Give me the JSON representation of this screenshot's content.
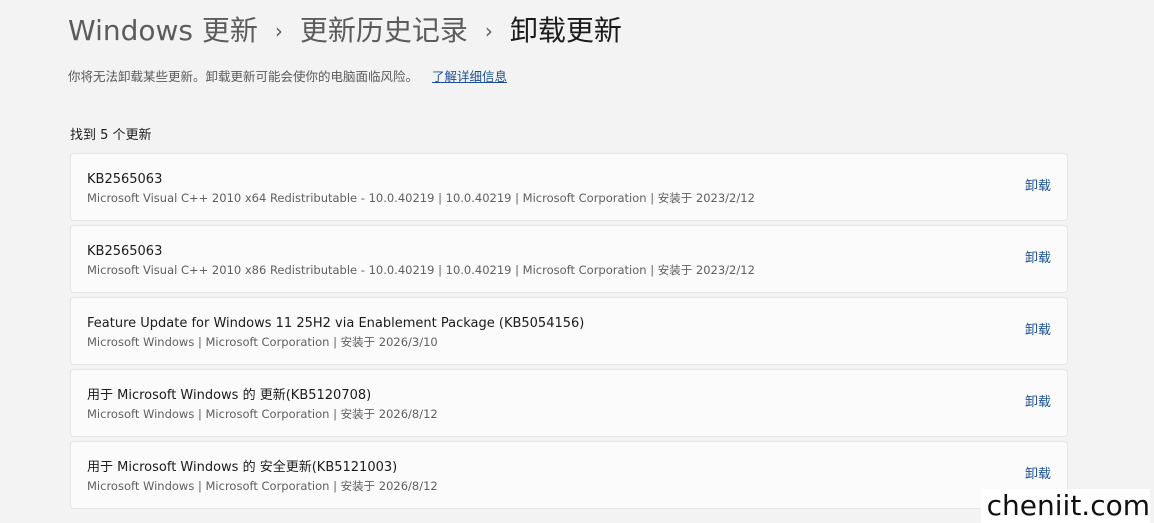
{
  "breadcrumb": {
    "items": [
      "Windows 更新",
      "更新历史记录",
      "卸载更新"
    ],
    "separator": "›"
  },
  "info": {
    "text": "你将无法卸载某些更新。卸载更新可能会使你的电脑面临风险。",
    "link": "了解详细信息"
  },
  "count_text": "找到 5 个更新",
  "updates": [
    {
      "title": "KB2565063",
      "details": "Microsoft Visual C++ 2010  x64 Redistributable - 10.0.40219  |  10.0.40219  |  Microsoft Corporation  |  安装于 2023/2/12",
      "action": "卸载"
    },
    {
      "title": "KB2565063",
      "details": "Microsoft Visual C++ 2010  x86 Redistributable - 10.0.40219  |  10.0.40219  |  Microsoft Corporation  |  安装于 2023/2/12",
      "action": "卸载"
    },
    {
      "title": "Feature Update for Windows 11 25H2 via Enablement Package (KB5054156)",
      "details": "Microsoft Windows  |  Microsoft Corporation  |  安装于 2026/3/10",
      "action": "卸载"
    },
    {
      "title": "用于 Microsoft Windows 的 更新(KB5120708)",
      "details": "Microsoft Windows  |  Microsoft Corporation  |  安装于 2026/8/12",
      "action": "卸载"
    },
    {
      "title": "用于 Microsoft Windows 的 安全更新(KB5121003)",
      "details": "Microsoft Windows  |  Microsoft Corporation  |  安装于 2026/8/12",
      "action": "卸载"
    }
  ],
  "watermark": "cheniit.com",
  "colors": {
    "background": "#f3f3f3",
    "card": "#fbfbfb",
    "accent": "#1e4f95",
    "secondary_text": "#5f5f5f"
  }
}
